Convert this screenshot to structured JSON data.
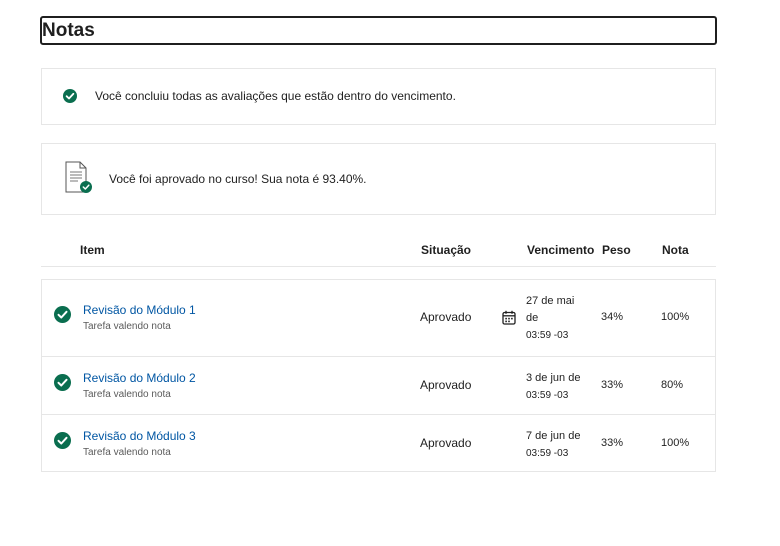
{
  "page": {
    "title": "Notas"
  },
  "banners": {
    "completed": "Você concluiu todas as avaliações que estão dentro do vencimento.",
    "passed": "Você foi aprovado no curso! Sua nota é 93.40%."
  },
  "table": {
    "headers": {
      "item": "Item",
      "status": "Situação",
      "due": "Vencimento",
      "weight": "Peso",
      "grade": "Nota"
    },
    "rows": [
      {
        "title": "Revisão do Módulo 1",
        "subtitle": "Tarefa valendo nota",
        "status": "Aprovado",
        "due_date_line1": "27 de mai",
        "due_date_line2": "de",
        "due_time": "03:59 -03",
        "weight": "34%",
        "grade": "100%"
      },
      {
        "title": "Revisão do Módulo 2",
        "subtitle": "Tarefa valendo nota",
        "status": "Aprovado",
        "due_date_line1": "3 de jun de",
        "due_time": "03:59 -03",
        "weight": "33%",
        "grade": "80%"
      },
      {
        "title": "Revisão do Módulo 3",
        "subtitle": "Tarefa valendo nota",
        "status": "Aprovado",
        "due_date_line1": "7 de jun de",
        "due_time": "03:59 -03",
        "weight": "33%",
        "grade": "100%"
      }
    ]
  },
  "icons": {
    "check": "check-circle-icon",
    "document": "document-check-icon",
    "calendar": "calendar-icon"
  },
  "colors": {
    "accent_green": "#0a6e4f",
    "link_blue": "#0056a3"
  }
}
